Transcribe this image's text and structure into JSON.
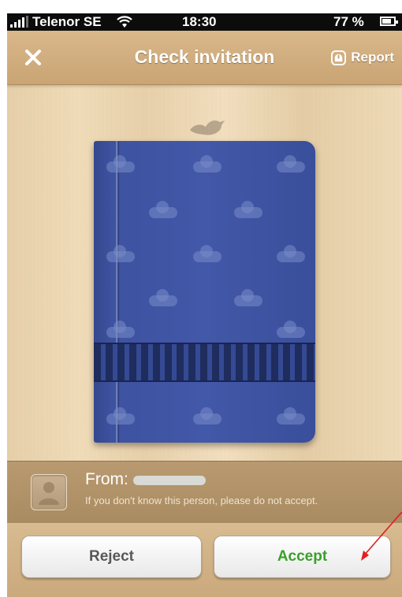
{
  "status_bar": {
    "carrier": "Telenor SE",
    "time": "18:30",
    "battery": "77 %"
  },
  "nav": {
    "close_icon": "close-icon",
    "title": "Check invitation",
    "report_label": "Report",
    "report_icon": "report-icon"
  },
  "invitation": {
    "from_label": "From:",
    "warning": "If you don't know this person, please do not accept."
  },
  "actions": {
    "reject_label": "Reject",
    "accept_label": "Accept"
  },
  "colors": {
    "accept_text": "#3aa02b",
    "reject_text": "#585858",
    "book_cover": "#4258a8",
    "annotation_arrow": "#e31e1e"
  }
}
